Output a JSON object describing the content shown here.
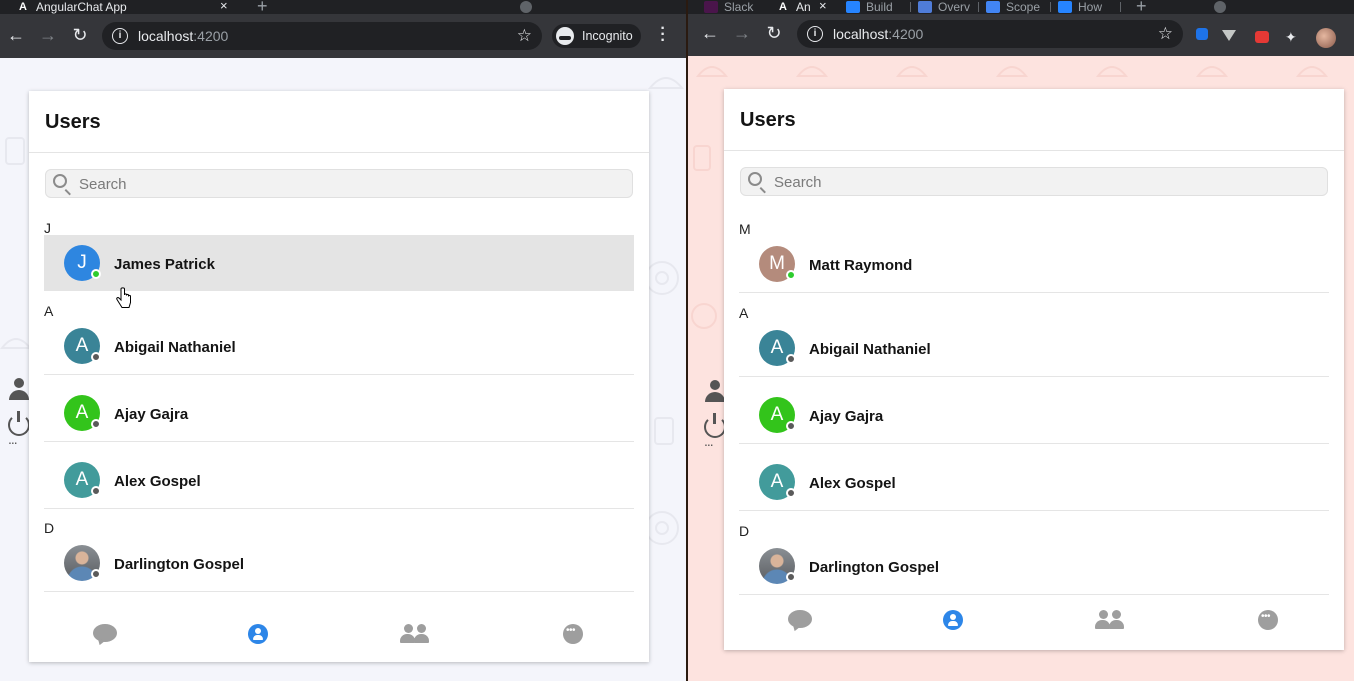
{
  "left_window": {
    "tab": {
      "title": "AngularChat App",
      "favicon": "A",
      "close": "×"
    },
    "address": {
      "host": "localhost",
      "port": ":4200"
    },
    "incognito_label": "Incognito",
    "page_bg": "#f4f5fb",
    "panel": {
      "title": "Users",
      "search_placeholder": "Search",
      "groups": [
        {
          "letter": "J",
          "users": [
            {
              "name": "James Patrick",
              "initial": "J",
              "color": "#2e86e0",
              "status": "online",
              "highlighted": true
            }
          ]
        },
        {
          "letter": "A",
          "users": [
            {
              "name": "Abigail Nathaniel",
              "initial": "A",
              "color": "#3a8497",
              "status": "offline"
            },
            {
              "name": "Ajay Gajra",
              "initial": "A",
              "color": "#33c41b",
              "status": "offline"
            },
            {
              "name": "Alex Gospel",
              "initial": "A",
              "color": "#429b9b",
              "status": "offline"
            }
          ]
        },
        {
          "letter": "D",
          "users": [
            {
              "name": "Darlington Gospel",
              "initial": "",
              "photo": true,
              "status": "offline"
            }
          ]
        }
      ]
    }
  },
  "right_window": {
    "tabs": [
      {
        "title": "Slack",
        "favicon": "slack-icon"
      },
      {
        "title": "An",
        "favicon": "A",
        "active": true
      },
      {
        "title": "Build",
        "favicon": "jira-icon"
      },
      {
        "title": "Overv",
        "favicon": "store-icon"
      },
      {
        "title": "Scope",
        "favicon": "docs-icon"
      },
      {
        "title": "How",
        "favicon": "jira-icon"
      }
    ],
    "address": {
      "host": "localhost",
      "port": ":4200"
    },
    "page_bg": "#fde3df",
    "panel": {
      "title": "Users",
      "search_placeholder": "Search",
      "groups": [
        {
          "letter": "M",
          "users": [
            {
              "name": "Matt Raymond",
              "initial": "M",
              "color": "#b48b7c",
              "status": "online"
            }
          ]
        },
        {
          "letter": "A",
          "users": [
            {
              "name": "Abigail Nathaniel",
              "initial": "A",
              "color": "#3a8497",
              "status": "offline"
            },
            {
              "name": "Ajay Gajra",
              "initial": "A",
              "color": "#33c41b",
              "status": "offline"
            },
            {
              "name": "Alex Gospel",
              "initial": "A",
              "color": "#429b9b",
              "status": "offline"
            }
          ]
        },
        {
          "letter": "D",
          "users": [
            {
              "name": "Darlington Gospel",
              "initial": "",
              "photo": true,
              "status": "offline"
            }
          ]
        }
      ]
    }
  },
  "bottom_nav": [
    "chats-icon",
    "contacts-icon",
    "groups-icon",
    "more-icon"
  ],
  "accent_color": "#2d86e8"
}
